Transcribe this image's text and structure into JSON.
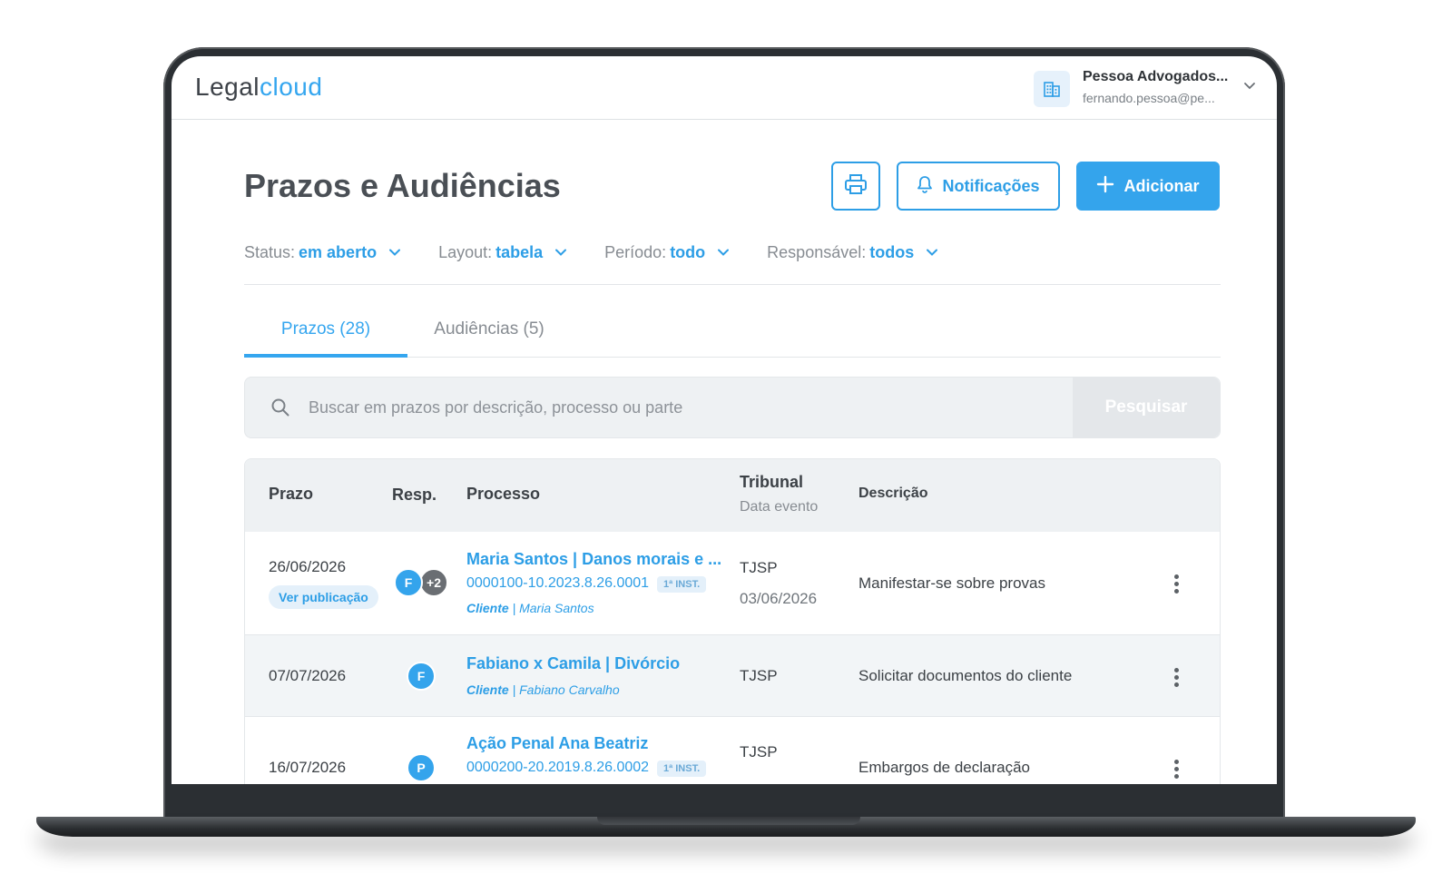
{
  "app": {
    "logo_part1": "Legal",
    "logo_part2": "cloud",
    "org_name": "Pessoa Advogados...",
    "org_email": "fernando.pessoa@pe..."
  },
  "page": {
    "title": "Prazos e Audiências",
    "notifications_label": "Notificações",
    "add_label": "Adicionar"
  },
  "filters": [
    {
      "key": "Status:",
      "value": "em aberto"
    },
    {
      "key": "Layout:",
      "value": "tabela"
    },
    {
      "key": "Período:",
      "value": "todo"
    },
    {
      "key": "Responsável:",
      "value": "todos"
    }
  ],
  "tabs": [
    {
      "label": "Prazos (28)",
      "active": true
    },
    {
      "label": "Audiências (5)",
      "active": false
    }
  ],
  "search": {
    "placeholder": "Buscar em prazos por descrição, processo ou parte",
    "button_label": "Pesquisar"
  },
  "table": {
    "headers": {
      "prazo": "Prazo",
      "resp": "Resp.",
      "processo": "Processo",
      "tribunal": "Tribunal",
      "data_evento": "Data evento",
      "descricao": "Descrição"
    },
    "rows": [
      {
        "prazo": "26/06/2026",
        "badge": "Ver publicação",
        "avatar": "F",
        "avatar_extra": "+2",
        "processo_title": "Maria Santos | Danos morais e ...",
        "processo_num": "0000100-10.2023.8.26.0001",
        "instancia": "1ª INST.",
        "party_role": "Cliente",
        "party_name": "| Maria Santos",
        "tribunal": "TJSP",
        "data_evento": "03/06/2026",
        "descricao": "Manifestar-se sobre provas"
      },
      {
        "prazo": "07/07/2026",
        "avatar": "F",
        "processo_title": "Fabiano x Camila | Divórcio",
        "party_role": "Cliente",
        "party_name": "| Fabiano Carvalho",
        "tribunal": "TJSP",
        "descricao": "Solicitar documentos do cliente"
      },
      {
        "prazo": "16/07/2026",
        "avatar": "P",
        "processo_title": "Ação Penal Ana Beatriz",
        "processo_num": "0000200-20.2019.8.26.0002",
        "instancia": "1ª INST.",
        "tribunal": "TJSP",
        "descricao": "Embargos de declaração"
      }
    ]
  },
  "colors": {
    "accent": "#34a4ec",
    "laptop_frame": "#2b2f33"
  },
  "icons": [
    "building-icon",
    "chevron-down-icon",
    "printer-icon",
    "bell-icon",
    "plus-icon",
    "search-icon",
    "kebab-menu-icon"
  ]
}
